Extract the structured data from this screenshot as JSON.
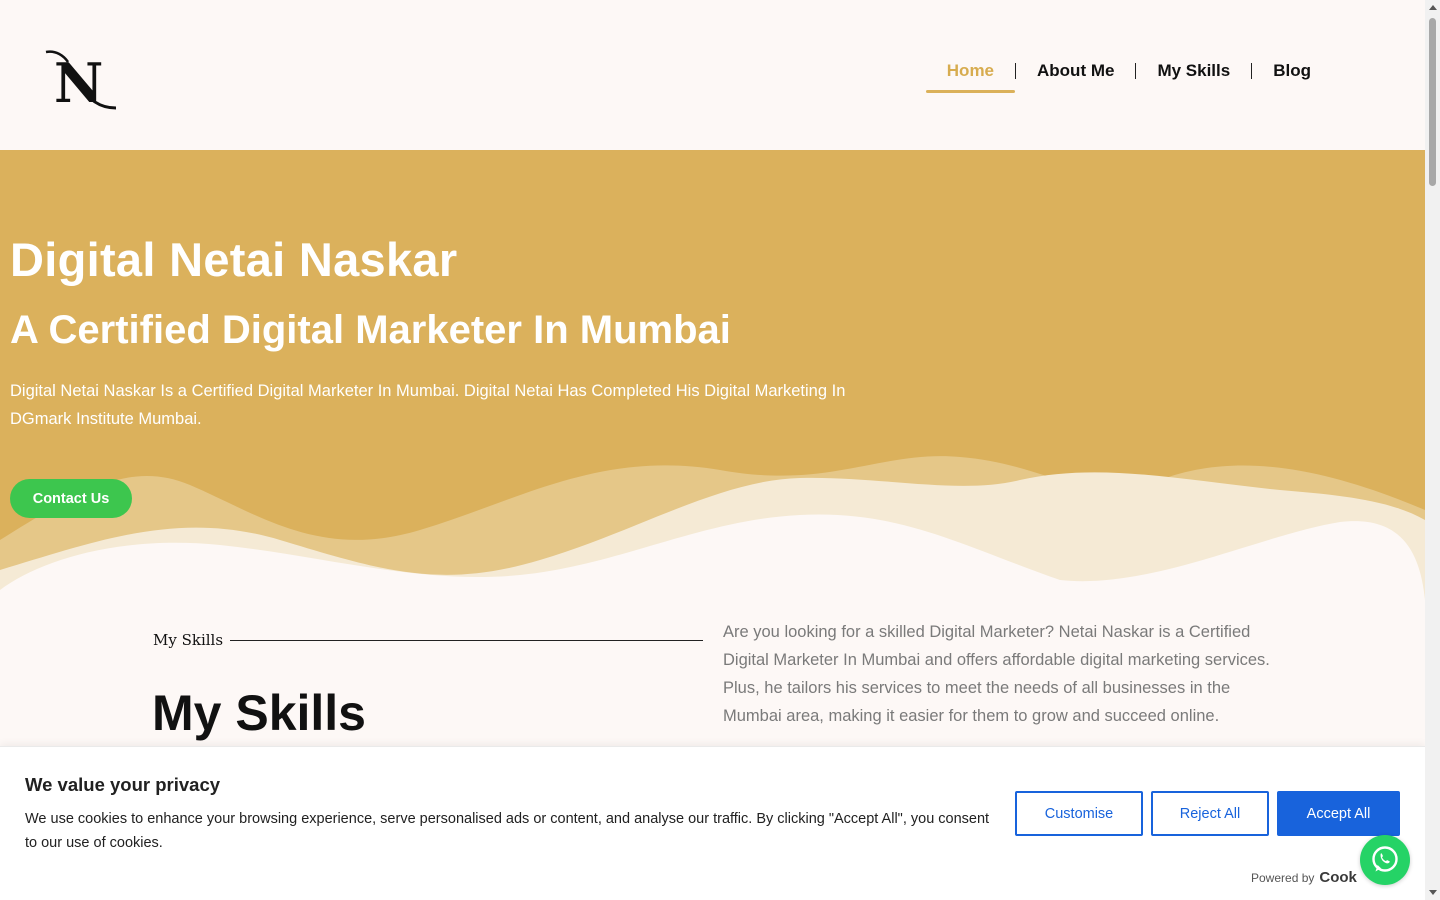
{
  "header": {
    "logo_icon": "n-monogram-logo",
    "nav": [
      {
        "label": "Home",
        "active": true
      },
      {
        "label": "About Me",
        "active": false
      },
      {
        "label": "My Skills",
        "active": false
      },
      {
        "label": "Blog",
        "active": false
      }
    ]
  },
  "hero": {
    "title": "Digital Netai Naskar",
    "subtitle": "A Certified Digital Marketer In Mumbai",
    "description": "Digital Netai Naskar Is a Certified Digital Marketer In Mumbai. Digital Netai Has Completed His Digital Marketing In DGmark Institute Mumbai.",
    "cta_label": "Contact Us"
  },
  "skills": {
    "kicker": "My Skills",
    "title": "My Skills",
    "text": "Are you looking for a skilled Digital Marketer? Netai Naskar is a Certified Digital Marketer In Mumbai and offers affordable digital marketing services. Plus, he tailors his services to meet the needs of all businesses in the Mumbai area, making it easier for them to grow and succeed online."
  },
  "cookie": {
    "title": "We value your privacy",
    "text": "We use cookies to enhance your browsing experience, serve personalised ads or content, and analyse our traffic. By clicking \"Accept All\", you consent to our use of cookies.",
    "customise_label": "Customise",
    "reject_label": "Reject All",
    "accept_label": "Accept All",
    "powered_label": "Powered by",
    "powered_brand": "Cook"
  },
  "colors": {
    "hero_bg": "#dbb15c",
    "accent_gold": "#d7ac4f",
    "cta_green": "#3dc64e",
    "cookie_blue": "#1863dc",
    "whatsapp_green": "#25d366"
  },
  "floating": {
    "whatsapp_icon": "whatsapp-icon"
  }
}
